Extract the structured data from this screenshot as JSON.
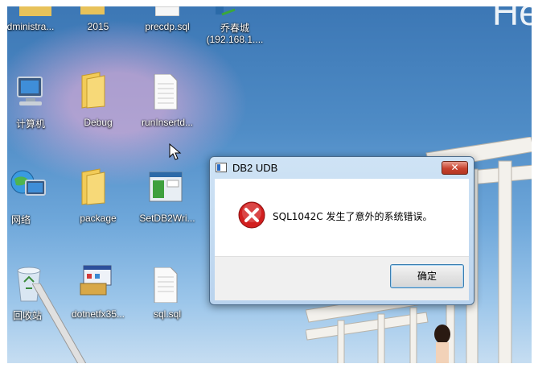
{
  "desktop": {
    "brand_text": "He",
    "icons": [
      {
        "label": "dministra..."
      },
      {
        "label": "2015"
      },
      {
        "label": "precdp.sql"
      },
      {
        "label": "乔春城"
      },
      {
        "label": "(192.168.1...."
      },
      {
        "label": "计算机"
      },
      {
        "label": "Debug"
      },
      {
        "label": "runInsertd..."
      },
      {
        "label": "网络"
      },
      {
        "label": "package"
      },
      {
        "label": "SetDB2Wri..."
      },
      {
        "label": "回收站"
      },
      {
        "label": "dotnetfx35..."
      },
      {
        "label": "sql.sql"
      }
    ]
  },
  "dialog": {
    "title": "DB2 UDB",
    "close_glyph": "✕",
    "message": "SQL1042C  发生了意外的系统错误。",
    "ok_label": "确定",
    "icon": "error-icon"
  },
  "colors": {
    "desktop_top": "#3b76b4",
    "desktop_bottom": "#c9dff2",
    "close_red": "#c8432f",
    "error_red": "#d21f1f"
  }
}
